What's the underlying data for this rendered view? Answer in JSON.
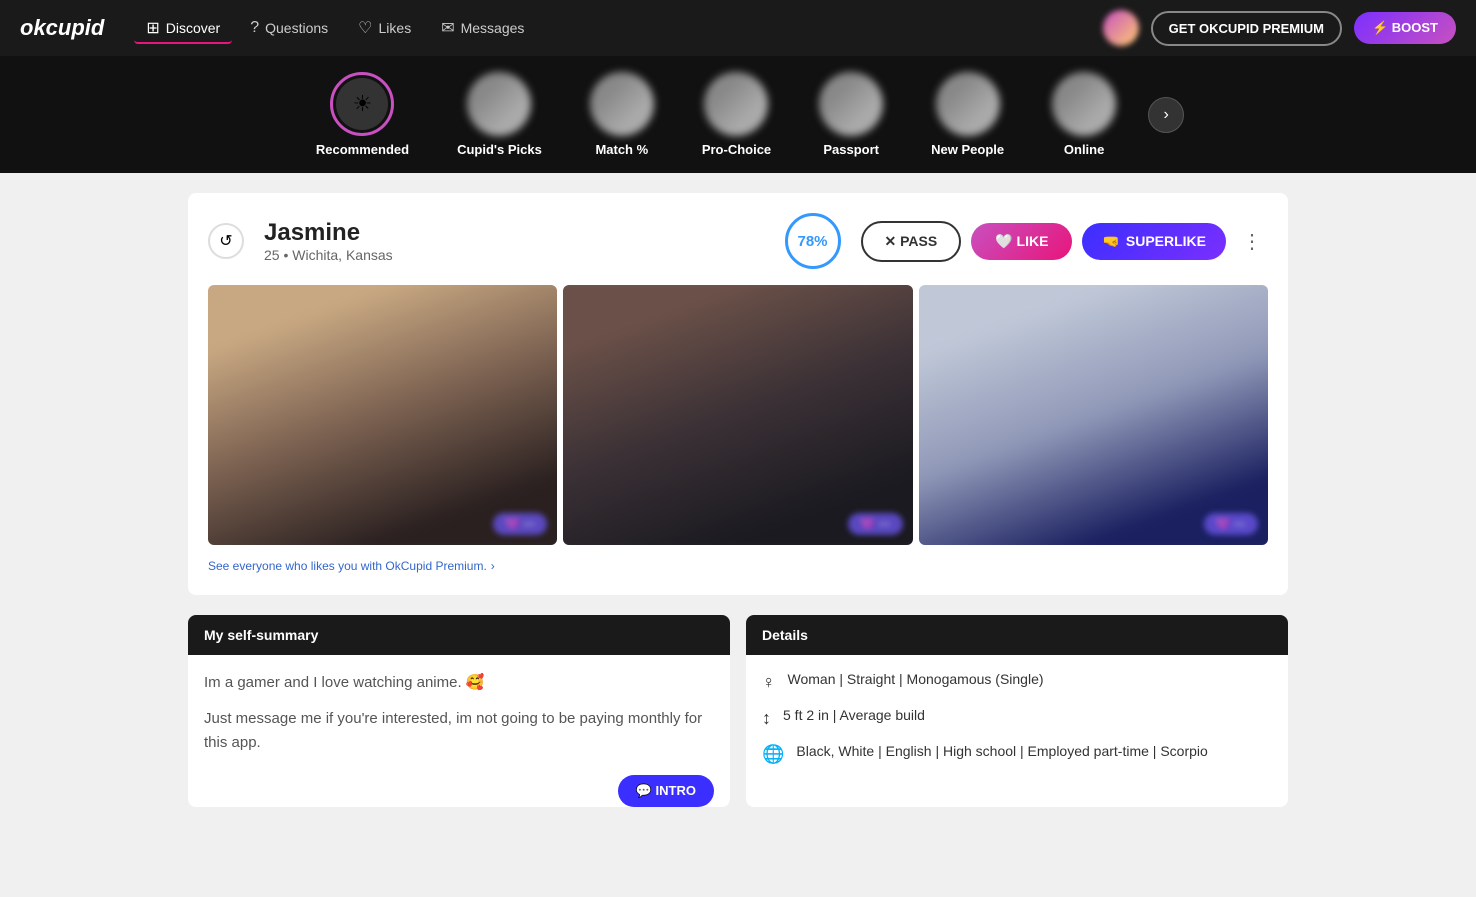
{
  "logo": "okcupid",
  "nav": {
    "items": [
      {
        "id": "discover",
        "label": "Discover",
        "icon": "⊞",
        "active": true
      },
      {
        "id": "questions",
        "label": "Questions",
        "icon": "?"
      },
      {
        "id": "likes",
        "label": "Likes",
        "icon": "♡"
      },
      {
        "id": "messages",
        "label": "Messages",
        "icon": "✉"
      }
    ]
  },
  "header_buttons": {
    "premium": "GET OKCUPID PREMIUM",
    "boost": "⚡ BOOST"
  },
  "categories": [
    {
      "id": "recommended",
      "label": "Recommended",
      "icon": "☀",
      "active": true
    },
    {
      "id": "cupids-picks",
      "label": "Cupid's Picks",
      "blurred": true
    },
    {
      "id": "match",
      "label": "Match %",
      "blurred": true
    },
    {
      "id": "pro-choice",
      "label": "Pro-Choice",
      "blurred": true
    },
    {
      "id": "passport",
      "label": "Passport",
      "blurred": true
    },
    {
      "id": "new-people",
      "label": "New People",
      "blurred": true
    },
    {
      "id": "online",
      "label": "Online",
      "blurred": true
    }
  ],
  "profile": {
    "name": "Jasmine",
    "age": "25",
    "location": "Wichita, Kansas",
    "match_pct": "78%",
    "actions": {
      "pass": "✕ PASS",
      "like": "🤍 LIKE",
      "superlike": "🤜 SUPERLIKE"
    },
    "photos_count": 3,
    "photo_like_badges": [
      "💜···",
      "💜···",
      "💜···"
    ],
    "premium_prompt": "See everyone who likes you with OkCupid Premium.",
    "self_summary": {
      "header": "My self-summary",
      "text1": "Im a gamer and I love watching anime. 🥰",
      "text2": "Just message me if you're interested, im not going to be paying monthly for this app.",
      "intro_btn": "💬 INTRO"
    },
    "details": {
      "header": "Details",
      "items": [
        {
          "icon": "♀",
          "text": "Woman | Straight | Monogamous (Single)"
        },
        {
          "icon": "↕",
          "text": "5 ft 2 in | Average build"
        },
        {
          "icon": "🌐",
          "text": "Black, White | English | High school | Employed part-time | Scorpio"
        }
      ]
    }
  }
}
